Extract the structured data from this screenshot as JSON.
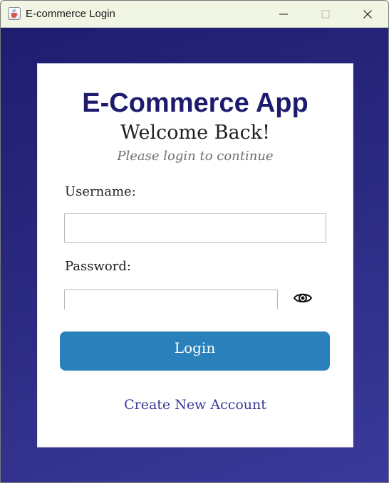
{
  "window": {
    "title": "E-commerce Login",
    "app_icon": "java-cup-icon",
    "controls": [
      "minimize-icon",
      "maximize-icon",
      "close-icon"
    ]
  },
  "login": {
    "app_title": "E-Commerce App",
    "welcome": "Welcome Back!",
    "subtitle": "Please login to continue",
    "username_label": "Username:",
    "username_value": "",
    "password_label": "Password:",
    "password_value": "",
    "show_password_icon": "eye-icon",
    "login_button": "Login",
    "create_account_link": "Create New Account"
  },
  "colors": {
    "background_gradient": [
      "#1e1d70",
      "#3a3a9a"
    ],
    "title_color": "#1c1b6e",
    "button_color": "#2a80bb",
    "link_color": "#3a3a96"
  }
}
